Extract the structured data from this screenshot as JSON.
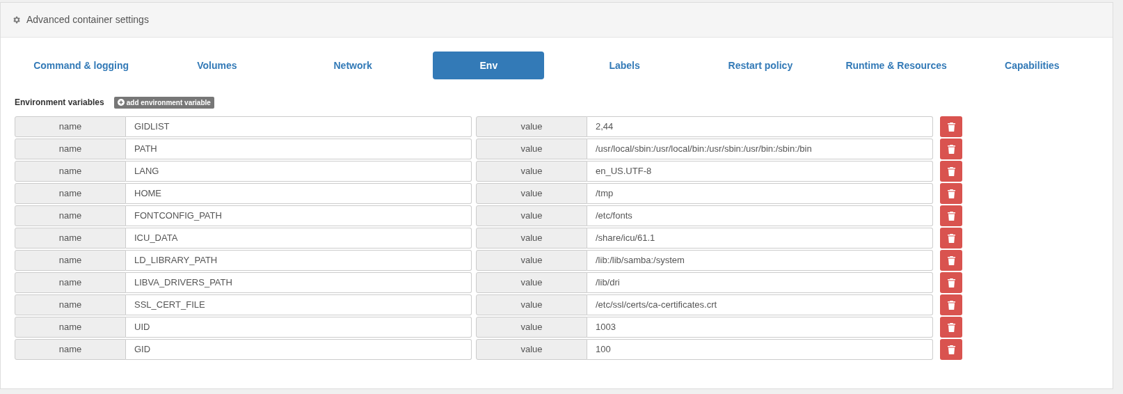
{
  "panel": {
    "title": "Advanced container settings"
  },
  "tabs": [
    {
      "label": "Command & logging",
      "selected": false
    },
    {
      "label": "Volumes",
      "selected": false
    },
    {
      "label": "Network",
      "selected": false
    },
    {
      "label": "Env",
      "selected": true
    },
    {
      "label": "Labels",
      "selected": false
    },
    {
      "label": "Restart policy",
      "selected": false
    },
    {
      "label": "Runtime & Resources",
      "selected": false
    },
    {
      "label": "Capabilities",
      "selected": false
    }
  ],
  "env": {
    "heading": "Environment variables",
    "add_button": "add environment variable",
    "variables": [
      {
        "name_label": "name",
        "name": "GIDLIST",
        "value_label": "value",
        "value": "2,44"
      },
      {
        "name_label": "name",
        "name": "PATH",
        "value_label": "value",
        "value": "/usr/local/sbin:/usr/local/bin:/usr/sbin:/usr/bin:/sbin:/bin"
      },
      {
        "name_label": "name",
        "name": "LANG",
        "value_label": "value",
        "value": "en_US.UTF-8"
      },
      {
        "name_label": "name",
        "name": "HOME",
        "value_label": "value",
        "value": "/tmp"
      },
      {
        "name_label": "name",
        "name": "FONTCONFIG_PATH",
        "value_label": "value",
        "value": "/etc/fonts"
      },
      {
        "name_label": "name",
        "name": "ICU_DATA",
        "value_label": "value",
        "value": "/share/icu/61.1"
      },
      {
        "name_label": "name",
        "name": "LD_LIBRARY_PATH",
        "value_label": "value",
        "value": "/lib:/lib/samba:/system"
      },
      {
        "name_label": "name",
        "name": "LIBVA_DRIVERS_PATH",
        "value_label": "value",
        "value": "/lib/dri"
      },
      {
        "name_label": "name",
        "name": "SSL_CERT_FILE",
        "value_label": "value",
        "value": "/etc/ssl/certs/ca-certificates.crt"
      },
      {
        "name_label": "name",
        "name": "UID",
        "value_label": "value",
        "value": "1003"
      },
      {
        "name_label": "name",
        "name": "GID",
        "value_label": "value",
        "value": "100"
      }
    ]
  }
}
